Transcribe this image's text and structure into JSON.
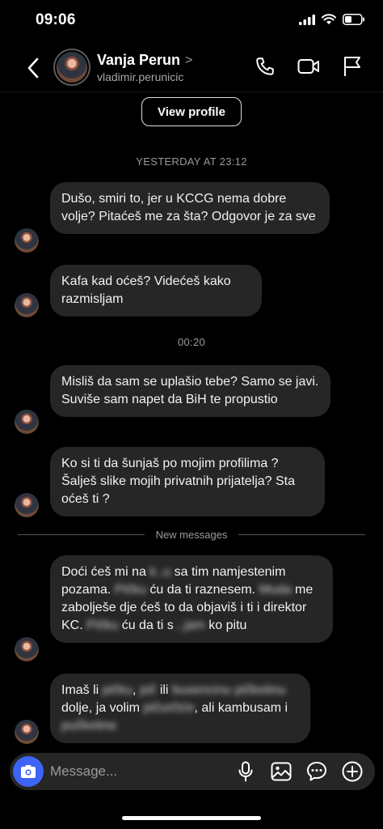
{
  "status": {
    "time": "09:06"
  },
  "header": {
    "name": "Vanja Perun",
    "name_chevron": ">",
    "username": "vladimir.perunicic",
    "icons": [
      "back-icon",
      "phone-icon",
      "video-icon",
      "flag-icon"
    ]
  },
  "chat": {
    "view_profile": "View profile",
    "timestamp_1": "YESTERDAY AT 23:12",
    "timestamp_2": "00:20",
    "new_messages": "New messages",
    "messages": [
      {
        "text": "Dušo, smiri to, jer u KCCG nema dobre volje? Pitaćeš me za šta? Odgovor je za sve"
      },
      {
        "text": "Kafa kad oćeš? Videćeš kako razmisljam"
      },
      {
        "text": "Misliš da sam se uplašio tebe? Samo se javi. Suviše sam napet da BiH te propustio"
      },
      {
        "text": "Ko si ti da šunjaš po mojim profilima ? Šalješ slike  mojih privatnih prijatelja? Sta oćeš ti ?"
      }
    ],
    "message_5": {
      "t1": "Doći ćeš mi na ",
      "b1": "k..u",
      "t2": " sa tim namjestenim pozama. ",
      "b2": "Pičku",
      "t3": " ću da ti raznesem. ",
      "b3": "Muda",
      "t4": " me zabolješe dje ćeš to da objaviš i ti i direktor KC. ",
      "b4": "Pičku",
      "t5": " ću da ti s",
      "b5": "...jam",
      "t6": " ko pitu"
    },
    "message_6": {
      "t1": "Imaš li ",
      "b1": "pičku",
      "t2": ", ",
      "b2": "pič",
      "t3": " ili ",
      "b3": "busencinu",
      "t4": " ",
      "b4": "pičketinu",
      "t5": " dolje, ja volim ",
      "b5": "pičurčiće",
      "t6": ", ali kambusam i ",
      "b6": "pučketine"
    }
  },
  "composer": {
    "placeholder": "Message...",
    "icons": [
      "camera-icon",
      "microphone-icon",
      "gallery-icon",
      "sticker-icon",
      "plus-icon"
    ]
  },
  "colors": {
    "accent": "#3e64f5",
    "bubble": "#262626",
    "background": "#000000"
  }
}
